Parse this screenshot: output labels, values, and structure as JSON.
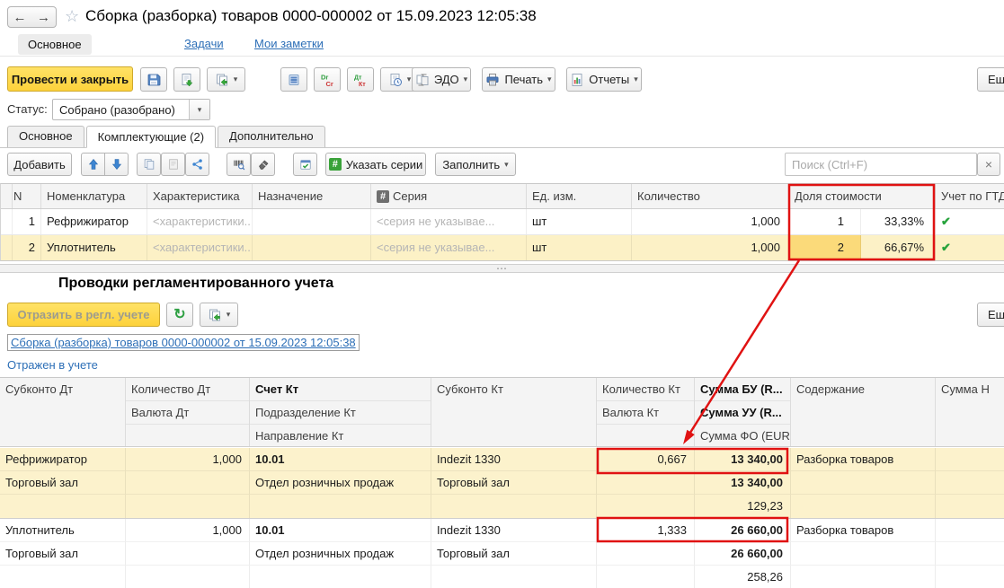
{
  "header": {
    "title": "Сборка (разборка) товаров 0000-000002 от 15.09.2023 12:05:38",
    "nav_tabs": {
      "main": "Основное",
      "tasks": "Задачи",
      "notes": "Мои заметки"
    }
  },
  "toolbar": {
    "post_and_close": "Провести и закрыть",
    "edo": "ЭДО",
    "print": "Печать",
    "reports": "Отчеты",
    "more": "Еще"
  },
  "status": {
    "label": "Статус:",
    "value": "Собрано (разобрано)"
  },
  "doc_tabs": {
    "main": "Основное",
    "components": "Комплектующие (2)",
    "additional": "Дополнительно"
  },
  "components": {
    "toolbar": {
      "add": "Добавить",
      "specify_series": "Указать серии",
      "fill": "Заполнить",
      "search_placeholder": "Поиск (Ctrl+F)"
    },
    "columns": {
      "n": "N",
      "nomenclature": "Номенклатура",
      "characteristic": "Характеристика",
      "purpose": "Назначение",
      "series": "Серия",
      "unit": "Ед. изм.",
      "quantity": "Количество",
      "cost_share": "Доля стоимости",
      "gtd": "Учет по ГТД"
    },
    "rows": [
      {
        "n": "1",
        "nomenclature": "Рефрижиратор",
        "characteristic": "<характеристики...",
        "purpose": "",
        "series": "<серия не указывае...",
        "unit": "шт",
        "quantity": "1,000",
        "share": "1",
        "share_pct": "33,33%"
      },
      {
        "n": "2",
        "nomenclature": "Уплотнитель",
        "characteristic": "<характеристики...",
        "purpose": "",
        "series": "<серия не указывае...",
        "unit": "шт",
        "quantity": "1,000",
        "share": "2",
        "share_pct": "66,67%"
      }
    ]
  },
  "postings": {
    "title": "Проводки регламентированного учета",
    "toolbar": {
      "reflect": "Отразить в регл. учете",
      "more": "Еще"
    },
    "doc_link": "Сборка (разборка) товаров 0000-000002 от 15.09.2023 12:05:38",
    "reflected_link": "Отражен в учете",
    "columns": {
      "c1": [
        "Субконто Дт"
      ],
      "c2": [
        "Количество Дт",
        "Валюта Дт"
      ],
      "c3": [
        "Счет Кт",
        "Подразделение Кт",
        "Направление Кт"
      ],
      "c4": [
        "Субконто Кт"
      ],
      "c5": [
        "Количество Кт",
        "Валюта Кт"
      ],
      "c6": [
        "Сумма БУ (R...",
        "Сумма УУ (R...",
        "Сумма ФО (EUR)"
      ],
      "c7": [
        "Содержание"
      ],
      "c8": [
        "Сумма Н"
      ]
    },
    "groups": [
      {
        "rows": [
          [
            "Рефрижиратор",
            "1,000",
            "10.01",
            "Indezit 1330",
            "0,667",
            "13 340,00",
            "Разборка товаров",
            ""
          ],
          [
            "Торговый зал",
            "",
            "Отдел розничных продаж",
            "Торговый зал",
            "",
            "13 340,00",
            "",
            ""
          ],
          [
            "",
            "",
            "",
            "",
            "",
            "129,23",
            "",
            ""
          ]
        ]
      },
      {
        "rows": [
          [
            "Уплотнитель",
            "1,000",
            "10.01",
            "Indezit 1330",
            "1,333",
            "26 660,00",
            "Разборка товаров",
            ""
          ],
          [
            "Торговый зал",
            "",
            "Отдел розничных продаж",
            "Торговый зал",
            "",
            "26 660,00",
            "",
            ""
          ],
          [
            "",
            "",
            "",
            "",
            "",
            "258,26",
            "",
            ""
          ]
        ]
      }
    ]
  },
  "icons": {
    "back": "←",
    "forward": "→",
    "star": "☆",
    "caret": "▾",
    "clear": "×",
    "check": "✔",
    "hash": "#",
    "refresh": "↻",
    "splitter_dots": "⋯"
  },
  "colors": {
    "accent_yellow": "#fdd23b",
    "annotation_red": "#e01212",
    "link_blue": "#2d6fb7",
    "check_green": "#27a33c",
    "selected_row": "#fcf1c6",
    "focused_cell": "#fbda7a"
  }
}
